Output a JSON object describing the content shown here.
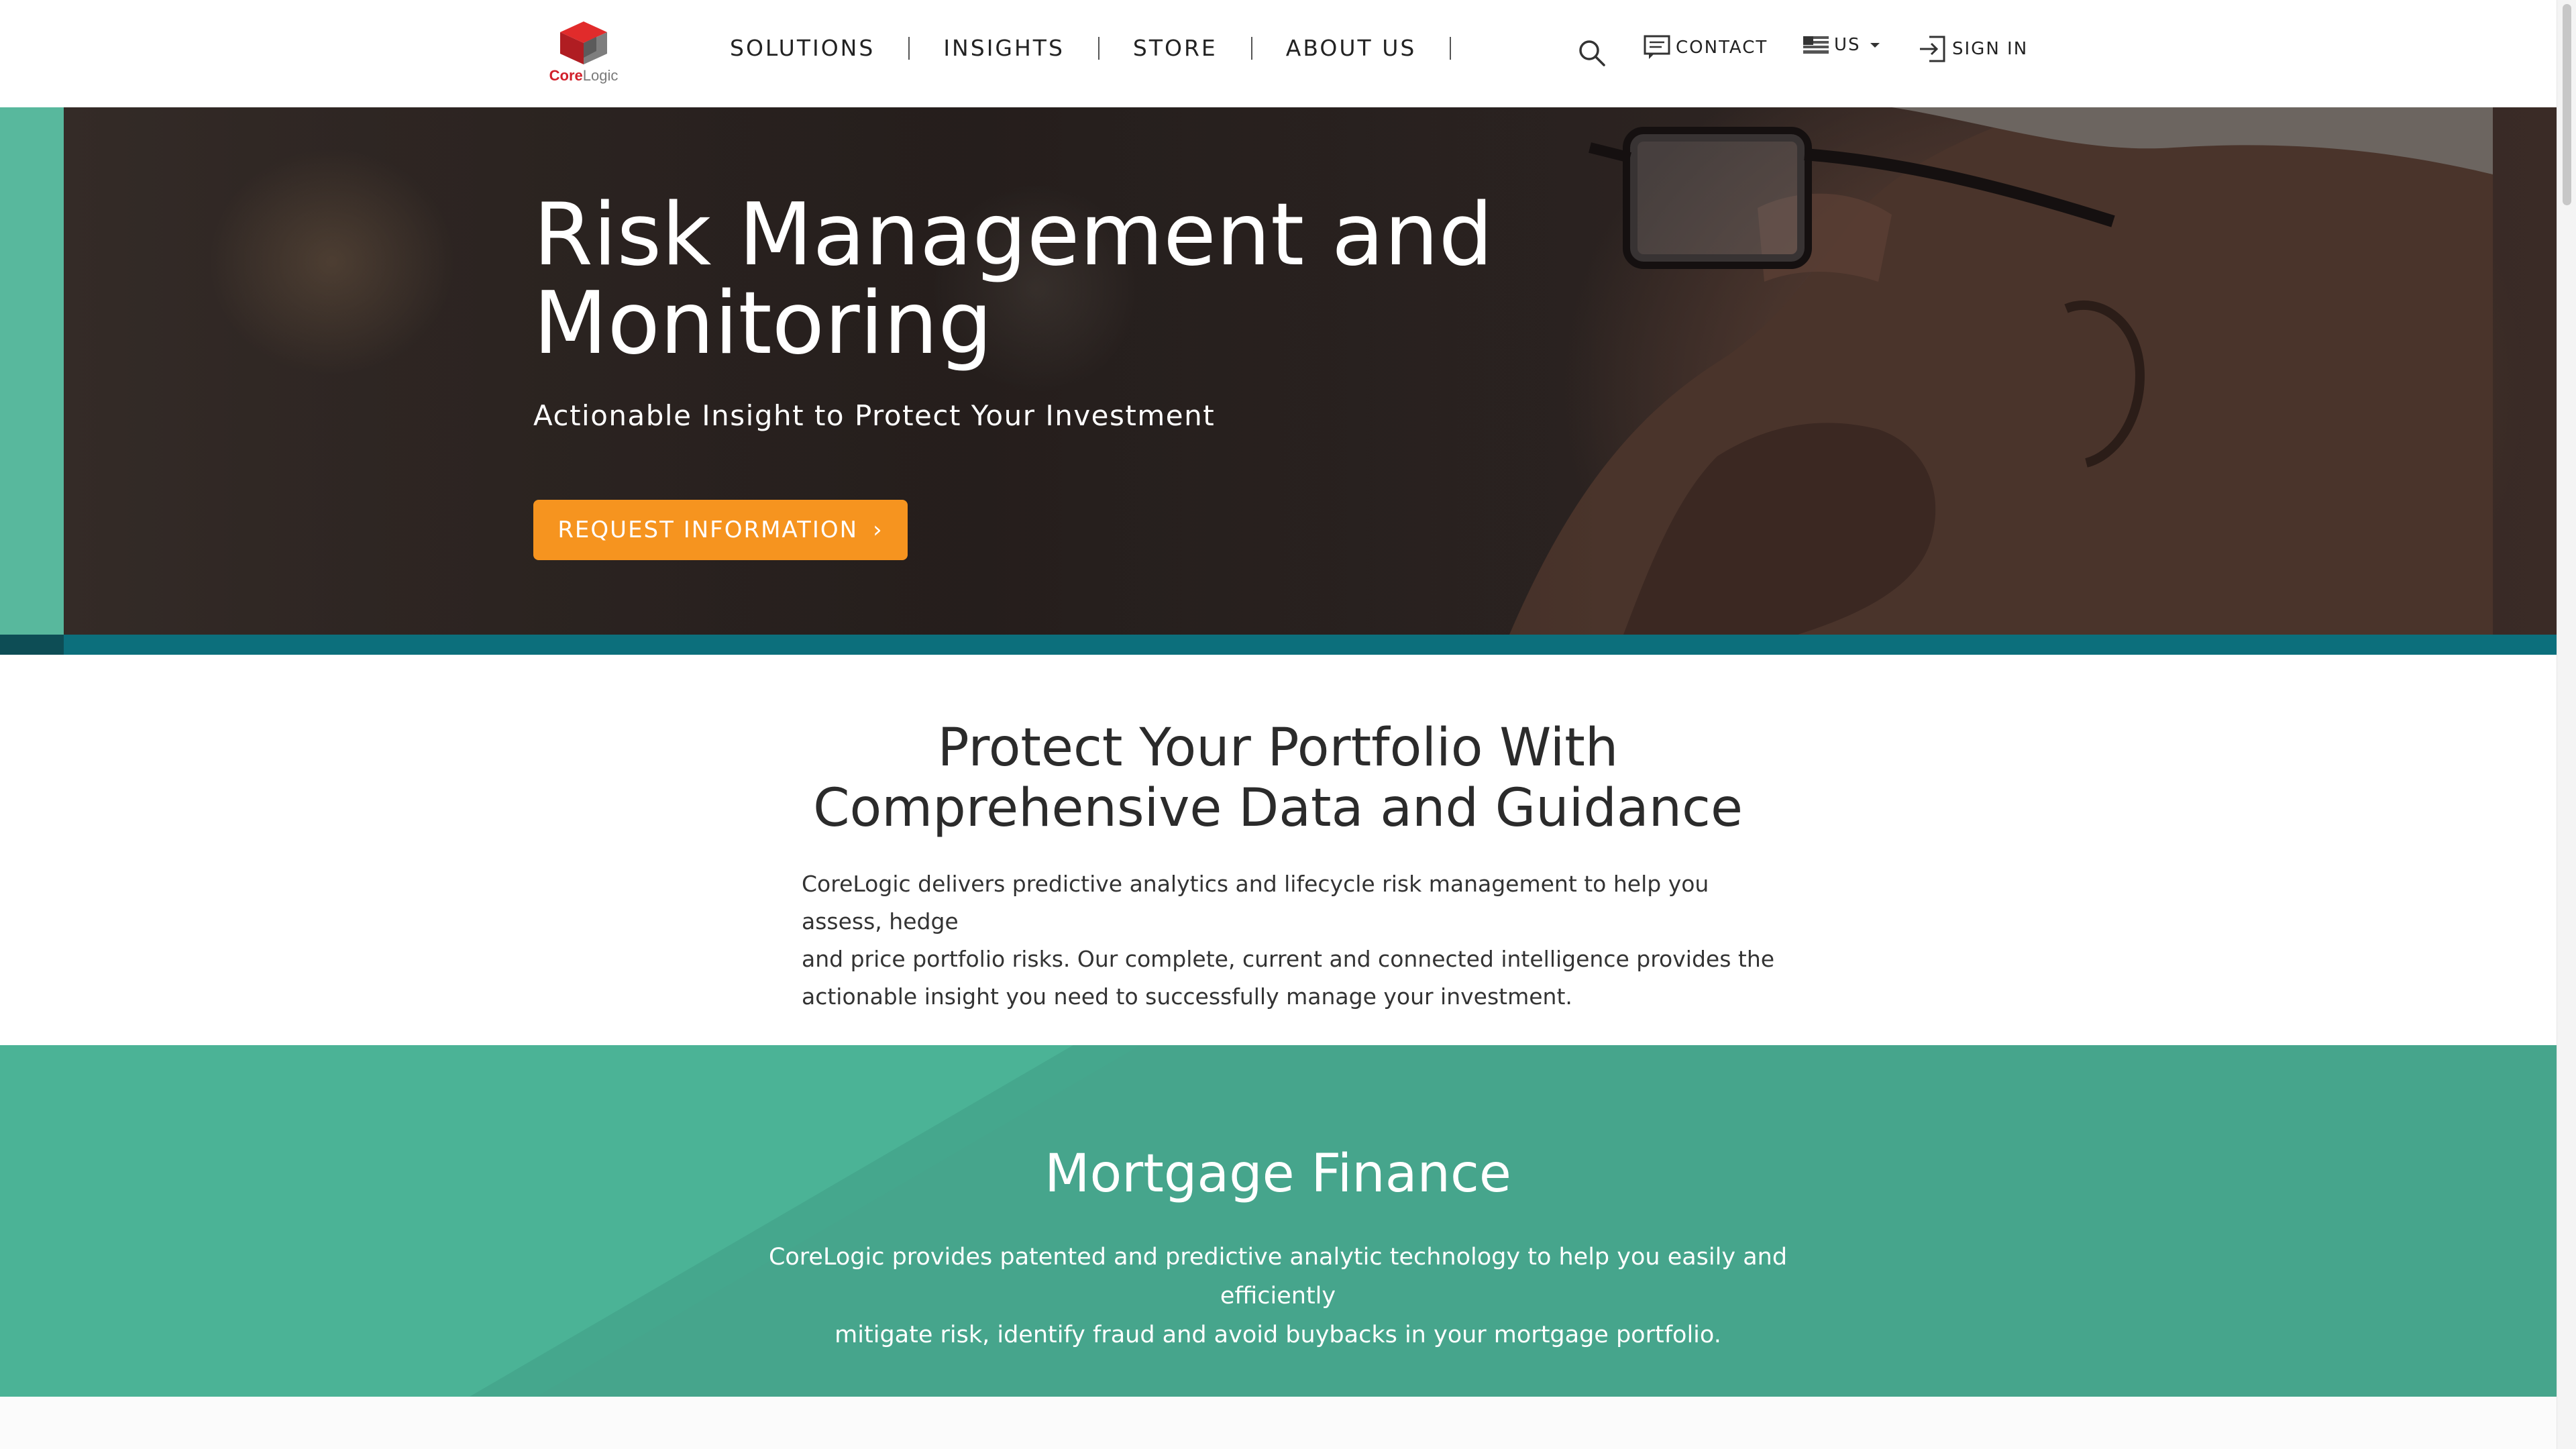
{
  "brand": {
    "name_red": "Core",
    "name_gray": "Logic",
    "mark": "®"
  },
  "nav": {
    "items": [
      {
        "label": "SOLUTIONS"
      },
      {
        "label": "INSIGHTS"
      },
      {
        "label": "STORE"
      },
      {
        "label": "ABOUT US"
      }
    ]
  },
  "utility": {
    "search_icon": "search-icon",
    "contact_label": "CONTACT",
    "region_label": "US",
    "signin_label": "SIGN IN"
  },
  "hero": {
    "title_line1": "Risk Management and",
    "title_line2": "Monitoring",
    "subtitle": "Actionable Insight to Protect Your Investment",
    "cta_label": "REQUEST INFORMATION",
    "cta_chevron": "›"
  },
  "intro": {
    "title_line1": "Protect Your Portfolio With",
    "title_line2": "Comprehensive Data and Guidance",
    "body_line1": "CoreLogic delivers predictive analytics and lifecycle risk management to help you assess, hedge",
    "body_line2": "and price portfolio risks. Our complete, current and connected intelligence provides the",
    "body_line3": "actionable insight you need to successfully manage your investment."
  },
  "mortgage_finance": {
    "title": "Mortgage Finance",
    "body_line1": "CoreLogic provides patented and predictive analytic technology to help you easily and efficiently",
    "body_line2": "mitigate risk, identify fraud and avoid buybacks in your mortgage portfolio."
  },
  "colors": {
    "accent_orange": "#f6941f",
    "teal_dark": "#0c6f7c",
    "green": "#46a58c",
    "brand_red": "#d11f2a"
  }
}
